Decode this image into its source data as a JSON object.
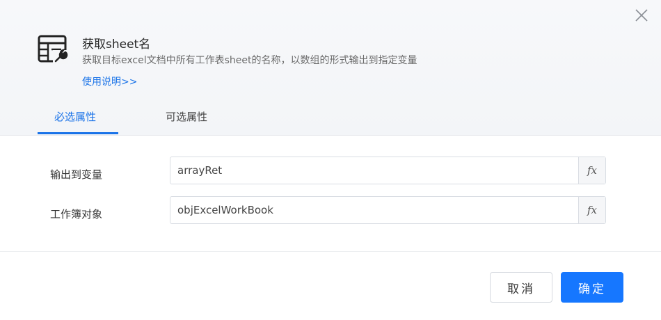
{
  "dialog": {
    "title": "获取sheet名",
    "description": "获取目标excel文档中所有工作表sheet的名称，以数组的形式输出到指定变量",
    "help_link": "使用说明>>",
    "icon": "excel-sheet-tool-icon",
    "close_icon": "close-icon"
  },
  "tabs": {
    "required": "必选属性",
    "optional": "可选属性"
  },
  "form": {
    "output_label": "输出到变量",
    "output_value": "arrayRet",
    "workbook_label": "工作簿对象",
    "workbook_value": "objExcelWorkBook",
    "fx_label": "fx"
  },
  "footer": {
    "cancel_label": "取消",
    "ok_label": "确定"
  },
  "colors": {
    "accent": "#1677ff",
    "link": "#1a73e8"
  }
}
